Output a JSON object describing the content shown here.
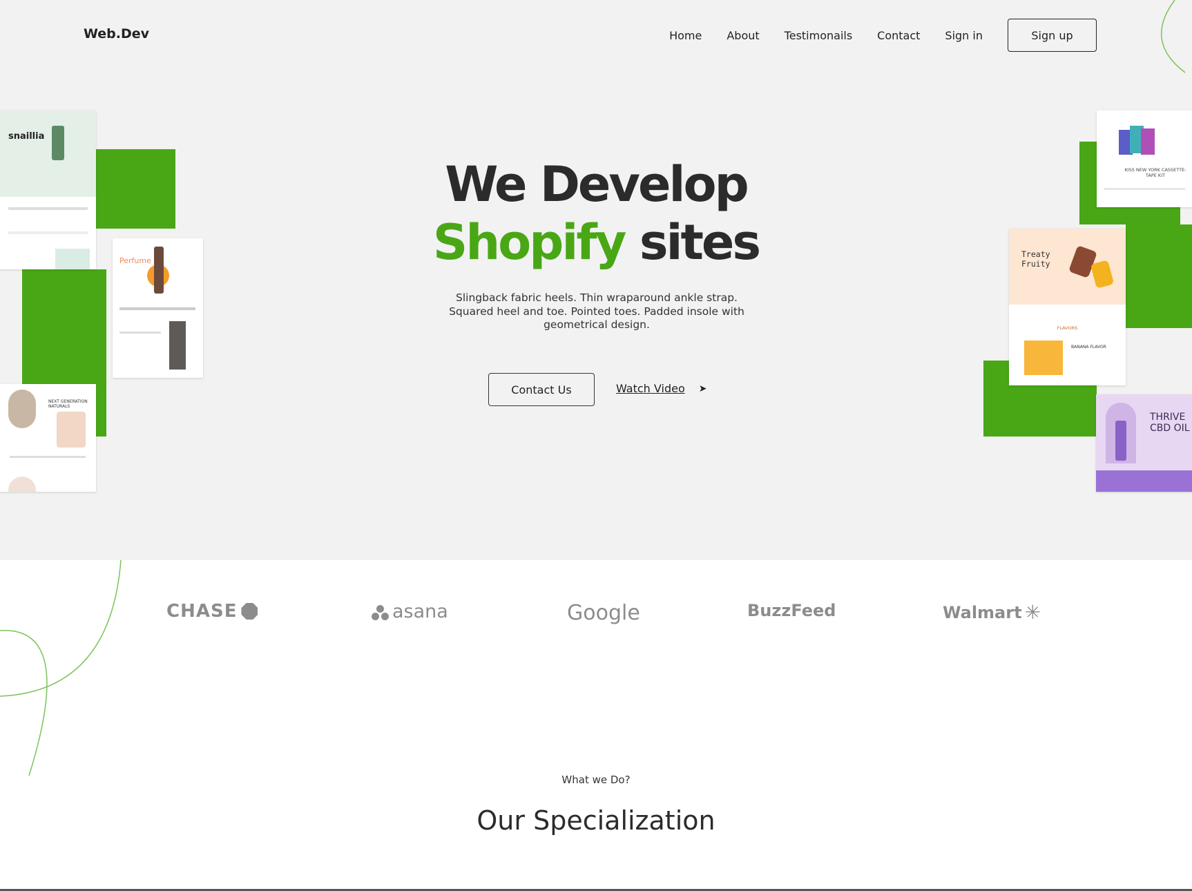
{
  "brand": "Web.Dev",
  "nav": {
    "items": [
      "Home",
      "About",
      "Testimonails",
      "Contact",
      "Sign in"
    ],
    "signup": "Sign up"
  },
  "hero": {
    "line1": "We Develop",
    "line2_accent": "Shopify",
    "line2_rest": "sites",
    "subtitle": "Slingback fabric heels. Thin wraparound ankle strap. Squared heel and toe. Pointed toes. Padded insole with geometrical design.",
    "contact_button": "Contact Us",
    "watch_video": "Watch Video"
  },
  "showcase": {
    "snaillia": "snaillia",
    "perfume": "Perfume",
    "natural": "NEXT GENERATION NATURALS",
    "kiss": "KISS NEW YORK CASSETTE-TAPE KIT",
    "treaty": "Treaty Fruity",
    "flavors": "FLAVORS",
    "banana": "BANANA FLAVOR",
    "thrive": "THRIVE CBD OIL"
  },
  "logos": [
    "CHASE",
    "asana",
    "Google",
    "BuzzFeed",
    "Walmart"
  ],
  "section": {
    "eyebrow": "What we Do?",
    "title": "Our Specialization"
  },
  "colors": {
    "accent": "#49a716",
    "hero_bg": "#f2f2f2"
  }
}
